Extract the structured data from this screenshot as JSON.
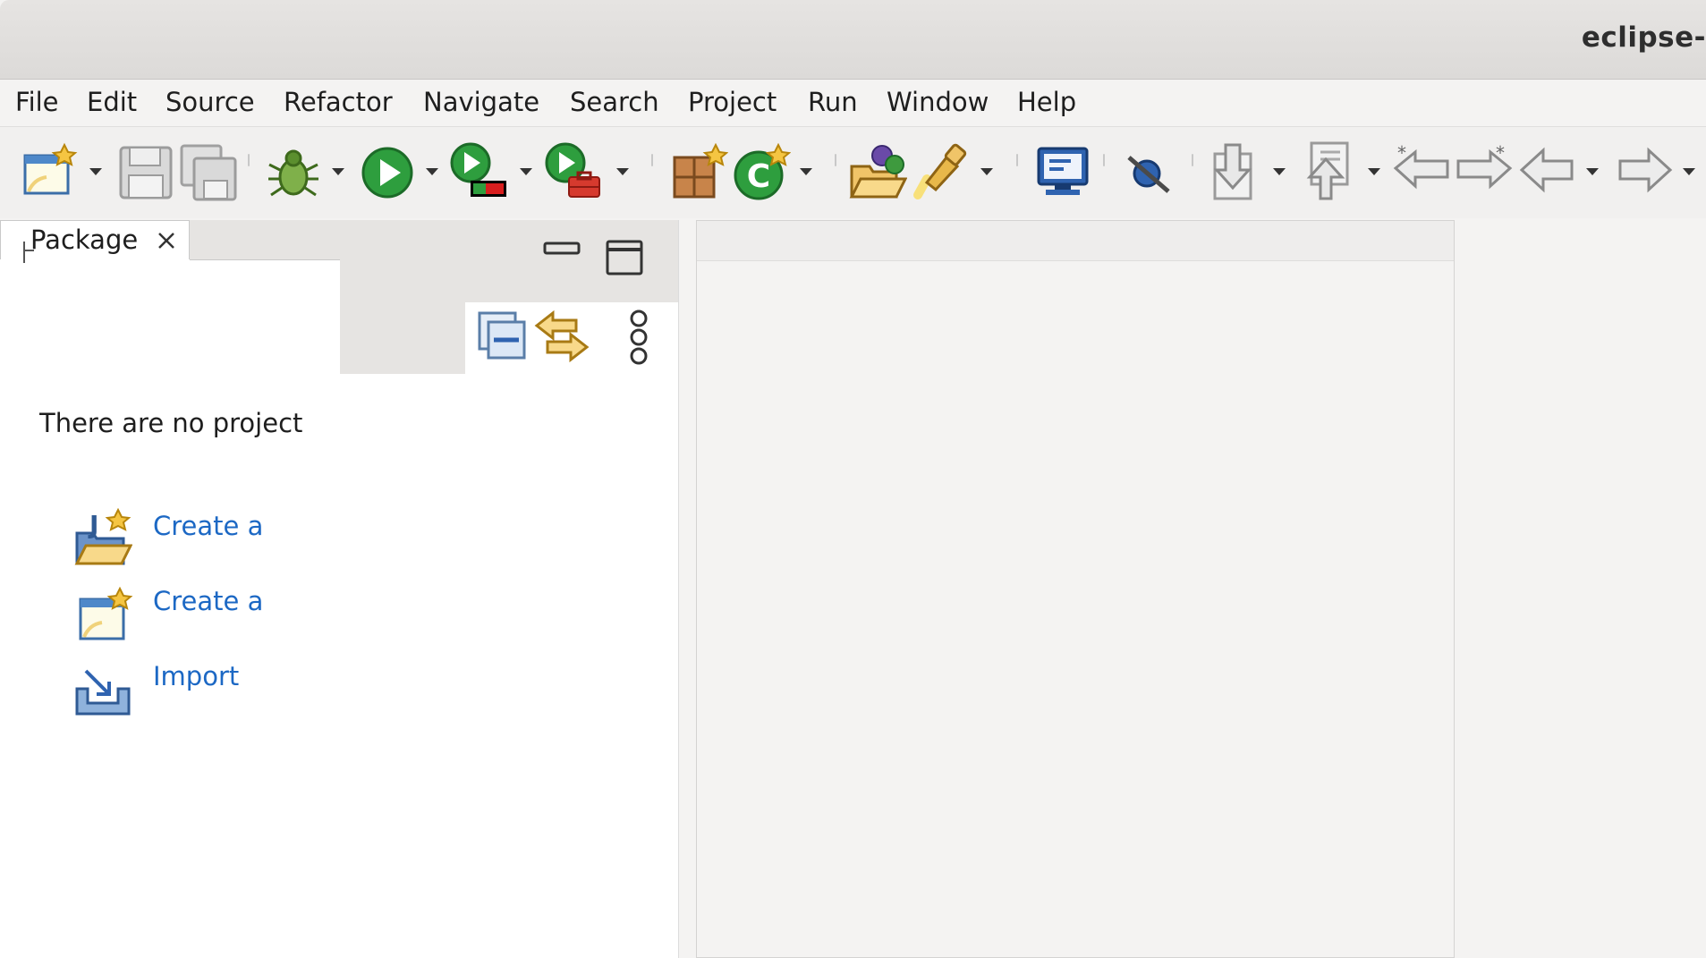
{
  "window": {
    "title": "eclipse-"
  },
  "menu": {
    "items": [
      "File",
      "Edit",
      "Source",
      "Refactor",
      "Navigate",
      "Search",
      "Project",
      "Run",
      "Window",
      "Help"
    ]
  },
  "toolbar": {
    "buttons": [
      "new-wizard-icon",
      "save-icon",
      "save-all-icon",
      "debug-icon",
      "run-icon",
      "coverage-icon",
      "external-tools-icon",
      "new-java-package-icon",
      "new-java-class-icon",
      "open-type-icon",
      "search-icon",
      "open-console-icon",
      "skip-breakpoints-icon",
      "next-annotation-icon",
      "previous-annotation-icon",
      "last-edit-icon",
      "next-edit-icon",
      "back-icon",
      "forward-icon"
    ]
  },
  "package_explorer": {
    "tab_label": "Package",
    "empty_message": "There are no project",
    "links": [
      {
        "icon": "new-java-project-icon",
        "label": "Create a"
      },
      {
        "icon": "new-project-icon",
        "label": "Create a"
      },
      {
        "icon": "import-icon",
        "label": "Import"
      }
    ]
  },
  "colors": {
    "link": "#1c68c4",
    "background": "#f4f3f2",
    "view_background": "#ffffff",
    "accent_green": "#2e9e3e"
  }
}
